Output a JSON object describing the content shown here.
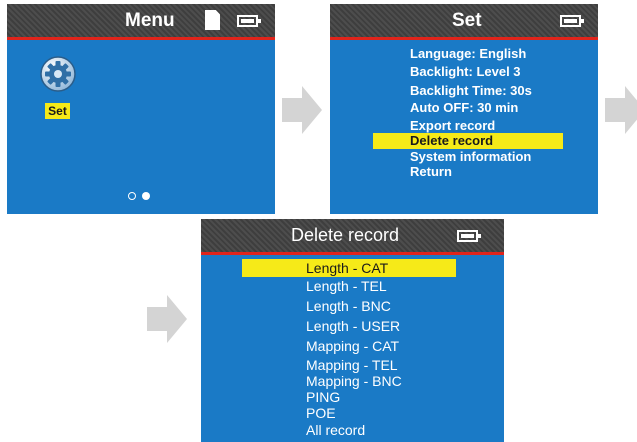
{
  "screen1": {
    "title": "Menu",
    "icons": {
      "sd": "sd-card-icon",
      "battery": "battery-icon",
      "gear": "gear-icon"
    },
    "app_label": "Set",
    "page_dots": 2
  },
  "screen2": {
    "title": "Set",
    "items": [
      "Language: English",
      "Backlight: Level 3",
      "Backlight Time: 30s",
      "Auto OFF: 30 min",
      "Export record",
      "Delete record",
      "System information",
      "Return"
    ],
    "selected_index": 5
  },
  "screen3": {
    "title": "Delete record",
    "items": [
      "Length - CAT",
      "Length - TEL",
      "Length - BNC",
      "Length - USER",
      "Mapping - CAT",
      "Mapping - TEL",
      "Mapping - BNC",
      "PING",
      "POE",
      "All record"
    ],
    "selected_index": 0
  },
  "colors": {
    "screen_bg": "#1a7ac6",
    "title_bar": "#444444",
    "title_underline": "#e0241b",
    "highlight": "#f6ea18",
    "arrow": "#d4d4d4"
  }
}
